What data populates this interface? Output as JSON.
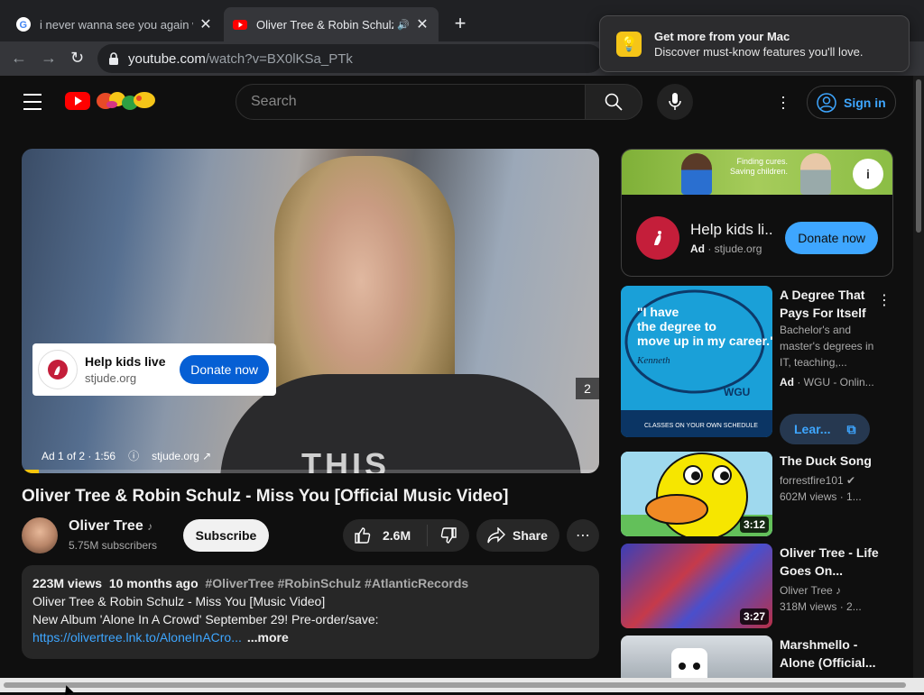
{
  "browser": {
    "tabs": [
      {
        "title": "i never wanna see you again w",
        "active": false
      },
      {
        "title": "Oliver Tree & Robin Schulz",
        "active": true
      }
    ],
    "url_host": "youtube.com",
    "url_path": "/watch?v=BX0lKSa_PTk"
  },
  "notification": {
    "title": "Get more from your Mac",
    "body": "Discover must-know features you'll love."
  },
  "header": {
    "search_placeholder": "Search",
    "signin_label": "Sign in"
  },
  "player": {
    "shirt_text": "THIS",
    "ad_card": {
      "headline": "Help kids live",
      "domain": "stjude.org",
      "cta": "Donate now"
    },
    "ad_badge": "2",
    "ad_info": "Ad 1 of 2 · 1:56",
    "ad_domain": "stjude.org",
    "progress": 0.03
  },
  "video": {
    "title": "Oliver Tree & Robin Schulz - Miss You [Official Music Video]",
    "channel": "Oliver Tree",
    "subscribers": "5.75M subscribers",
    "subscribe_label": "Subscribe",
    "likes": "2.6M",
    "share_label": "Share"
  },
  "description": {
    "views": "223M views",
    "age": "10 months ago",
    "tags": "#OliverTree #RobinSchulz #AtlanticRecords",
    "line1": "Oliver Tree & Robin Schulz - Miss You [Music Video]",
    "line2": "New Album 'Alone In A Crowd' September 29! Pre-order/save:",
    "link": "https://olivertree.lnk.to/AloneInACro...",
    "more": "...more"
  },
  "side_ad": {
    "banner_caption": "Finding cures. Saving children.",
    "headline": "Help kids li...",
    "ad_label": "Ad",
    "domain": "stjude.org",
    "cta": "Donate now"
  },
  "recommendations": [
    {
      "title": "A Degree That Pays For Itself",
      "meta1": "Bachelor's and master's degrees in IT, teaching,...",
      "meta2_ad": "Ad",
      "meta2": "· WGU - Onlin...",
      "cta": "Lear...",
      "thumb_text": "I have the degree to move up in my career.",
      "thumb_sig": "Kenneth",
      "thumb_footer": "CLASSES ON YOUR OWN SCHEDULE",
      "thumb_brand": "WGU"
    },
    {
      "title": "The Duck Song",
      "channel": "forrestfire101",
      "stats": "602M views · 1...",
      "duration": "3:12"
    },
    {
      "title": "Oliver Tree - Life Goes On...",
      "channel": "Oliver Tree",
      "stats": "318M views · 2...",
      "duration": "3:27"
    },
    {
      "title": "Marshmello - Alone (Official..."
    }
  ]
}
